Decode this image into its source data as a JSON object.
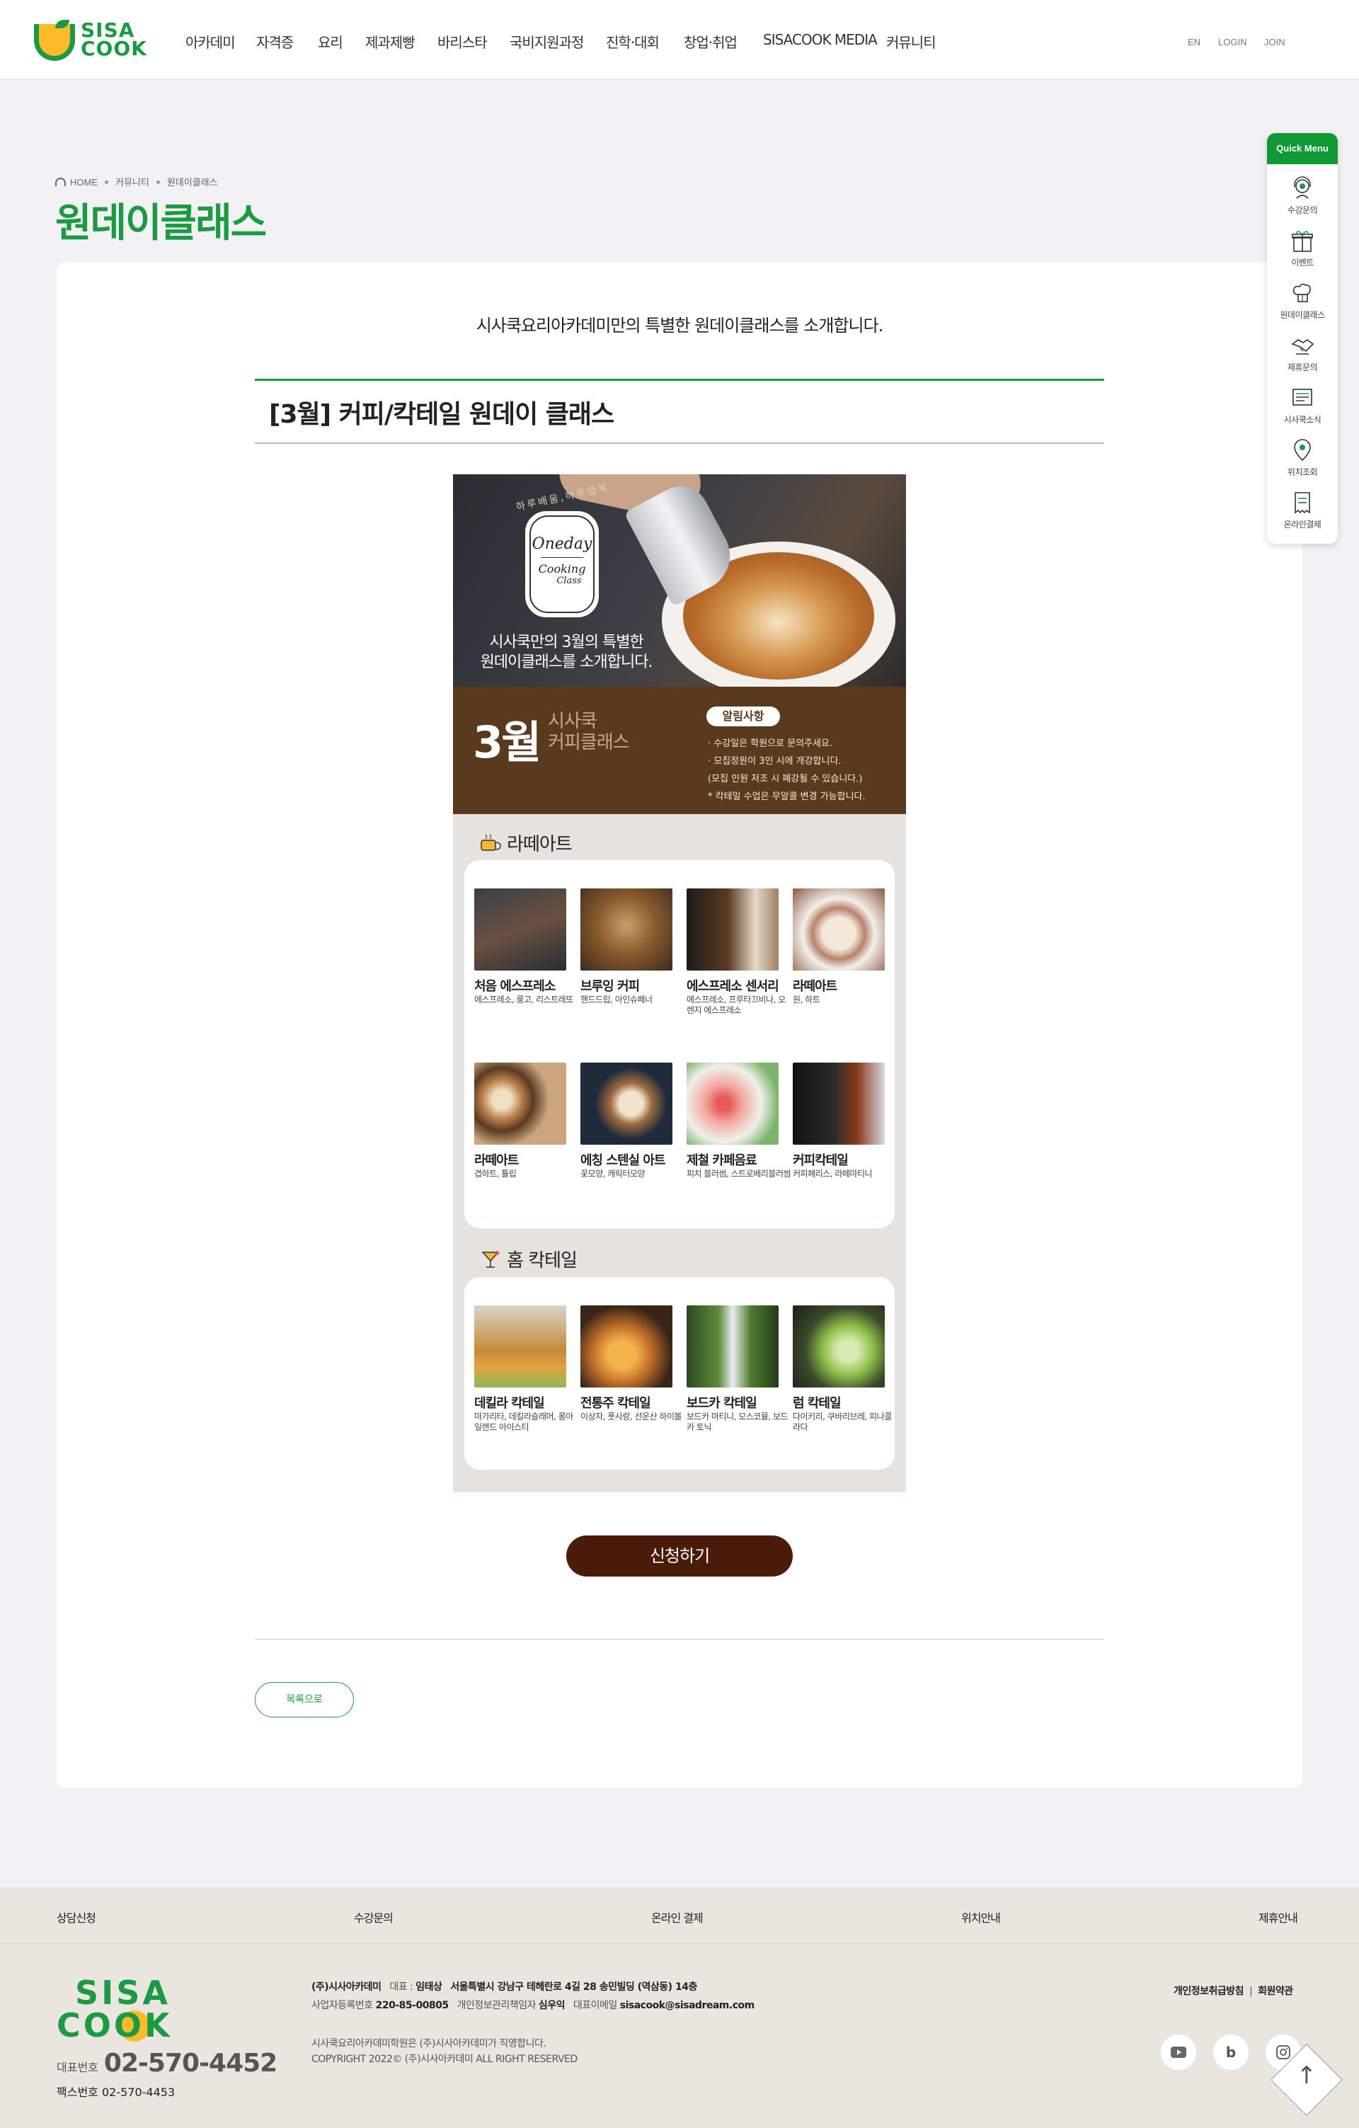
{
  "header": {
    "logo_line1": "SISA",
    "logo_line2": "COOK",
    "nav": [
      "아카데미",
      "자격증",
      "요리",
      "제과제빵",
      "바리스타",
      "국비지원과정",
      "진학·대회",
      "창업·취업",
      "SISACOOK MEDIA",
      "커뮤니티"
    ],
    "util": [
      "EN",
      "LOGIN",
      "JOIN"
    ]
  },
  "breadcrumb": [
    "HOME",
    "커뮤니티",
    "원데이클래스"
  ],
  "page_title": "원데이클래스",
  "intro": "시사쿡요리아카데미만의 특별한 원데이클래스를 소개합니다.",
  "post": {
    "title": "[3월] 커피/칵테일 원데이 클래스",
    "apply_label": "신청하기",
    "list_label": "목록으로"
  },
  "poster": {
    "badge_arc": "하루배움,하루행복",
    "badge_line1": "Oneday",
    "badge_line2": "Cooking",
    "badge_line3": "Class",
    "hero_line1": "시사쿡만의 3월의 특별한",
    "hero_line2": "원데이클래스를 소개합니다.",
    "month": "3월",
    "month_sub1": "시사쿡",
    "month_sub2": "커피클래스",
    "notice_title": "알림사항",
    "notices": [
      "· 수강일은 학원으로 문의주세요.",
      "· 모집정원이 3인 시에 개강합니다.",
      "  (모집 인원 저조 시 폐강될 수 있습니다.)",
      "* 칵테일 수업은 무알콜 변경 가능합니다."
    ],
    "section1": {
      "title": "라떼아트",
      "items": [
        {
          "name": "처음 에스프레소",
          "desc": "에스프레소, 룽고, 리스트레또"
        },
        {
          "name": "브루잉 커피",
          "desc": "핸드드립, 아인슈페너"
        },
        {
          "name": "에스프레소 센서리",
          "desc": "에스프레소, 프루타끄비나, 오렌지 에스프레소"
        },
        {
          "name": "라떼아트",
          "desc": "원, 하트"
        },
        {
          "name": "라떼아트",
          "desc": "겹하트, 튤립"
        },
        {
          "name": "에칭 스텐실 아트",
          "desc": "꽃모양, 캐릭터모양"
        },
        {
          "name": "제철 카페음료",
          "desc": "피치 블러썸, 스트로베리블러썸"
        },
        {
          "name": "커피칵테일",
          "desc": "커피페리스, 라떼마티니"
        }
      ]
    },
    "section2": {
      "title": "홈 칵테일",
      "items": [
        {
          "name": "데킬라 칵테일",
          "desc": "마가리타, 데킬라슬래머, 롱아일랜드 아이스티"
        },
        {
          "name": "전통주 칵테일",
          "desc": "이상자, 풋사랑, 선운산 하이볼"
        },
        {
          "name": "보드카 칵테일",
          "desc": "보드카 마티니, 모스코뮬, 보드카 토닉"
        },
        {
          "name": "럼 칵테일",
          "desc": "다이키리, 쿠바리브레, 피나콜라다"
        }
      ]
    }
  },
  "quick_menu": {
    "title": "Quick Menu",
    "items": [
      "수강문의",
      "이벤트",
      "원데이클래스",
      "제휴문의",
      "시사쿡소식",
      "위치조회",
      "온라인결제"
    ]
  },
  "footer": {
    "links": [
      "상담신청",
      "수강문의",
      "온라인 결제",
      "위치안내",
      "제휴안내"
    ],
    "logo_line1": "SISA",
    "logo_line2": "COOK",
    "tel_label": "대표번호",
    "tel": "02-570-4452",
    "fax_label": "팩스번호",
    "fax": "02-570-4453",
    "company": "(주)시사아카데미",
    "ceo_label": "대표 :",
    "ceo": "임태상",
    "address": "서울특별시 강남구 테헤란로 4길 28 송민빌딩 (역삼동) 14층",
    "biz_label": "사업자등록번호",
    "biz": "220-85-00805",
    "privacy_label": "개인정보관리책임자",
    "privacy_person": "심우익",
    "email_label": "대표이메일",
    "email": "sisacook@sisadream.com",
    "operated": "시사쿡요리아카데미학원은 (주)시사아카데미가 직영합니다.",
    "copyright": "COPYRIGHT 2022© (주)시사아카데미 ALL RIGHT RESERVED",
    "policy1": "개인정보취급방침",
    "policy_sep": "|",
    "policy2": "회원약관"
  },
  "colors": {
    "brand_green": "#1b9a43",
    "poster_brown": "#5a3a1f",
    "button_brown": "#4a1a0a"
  }
}
